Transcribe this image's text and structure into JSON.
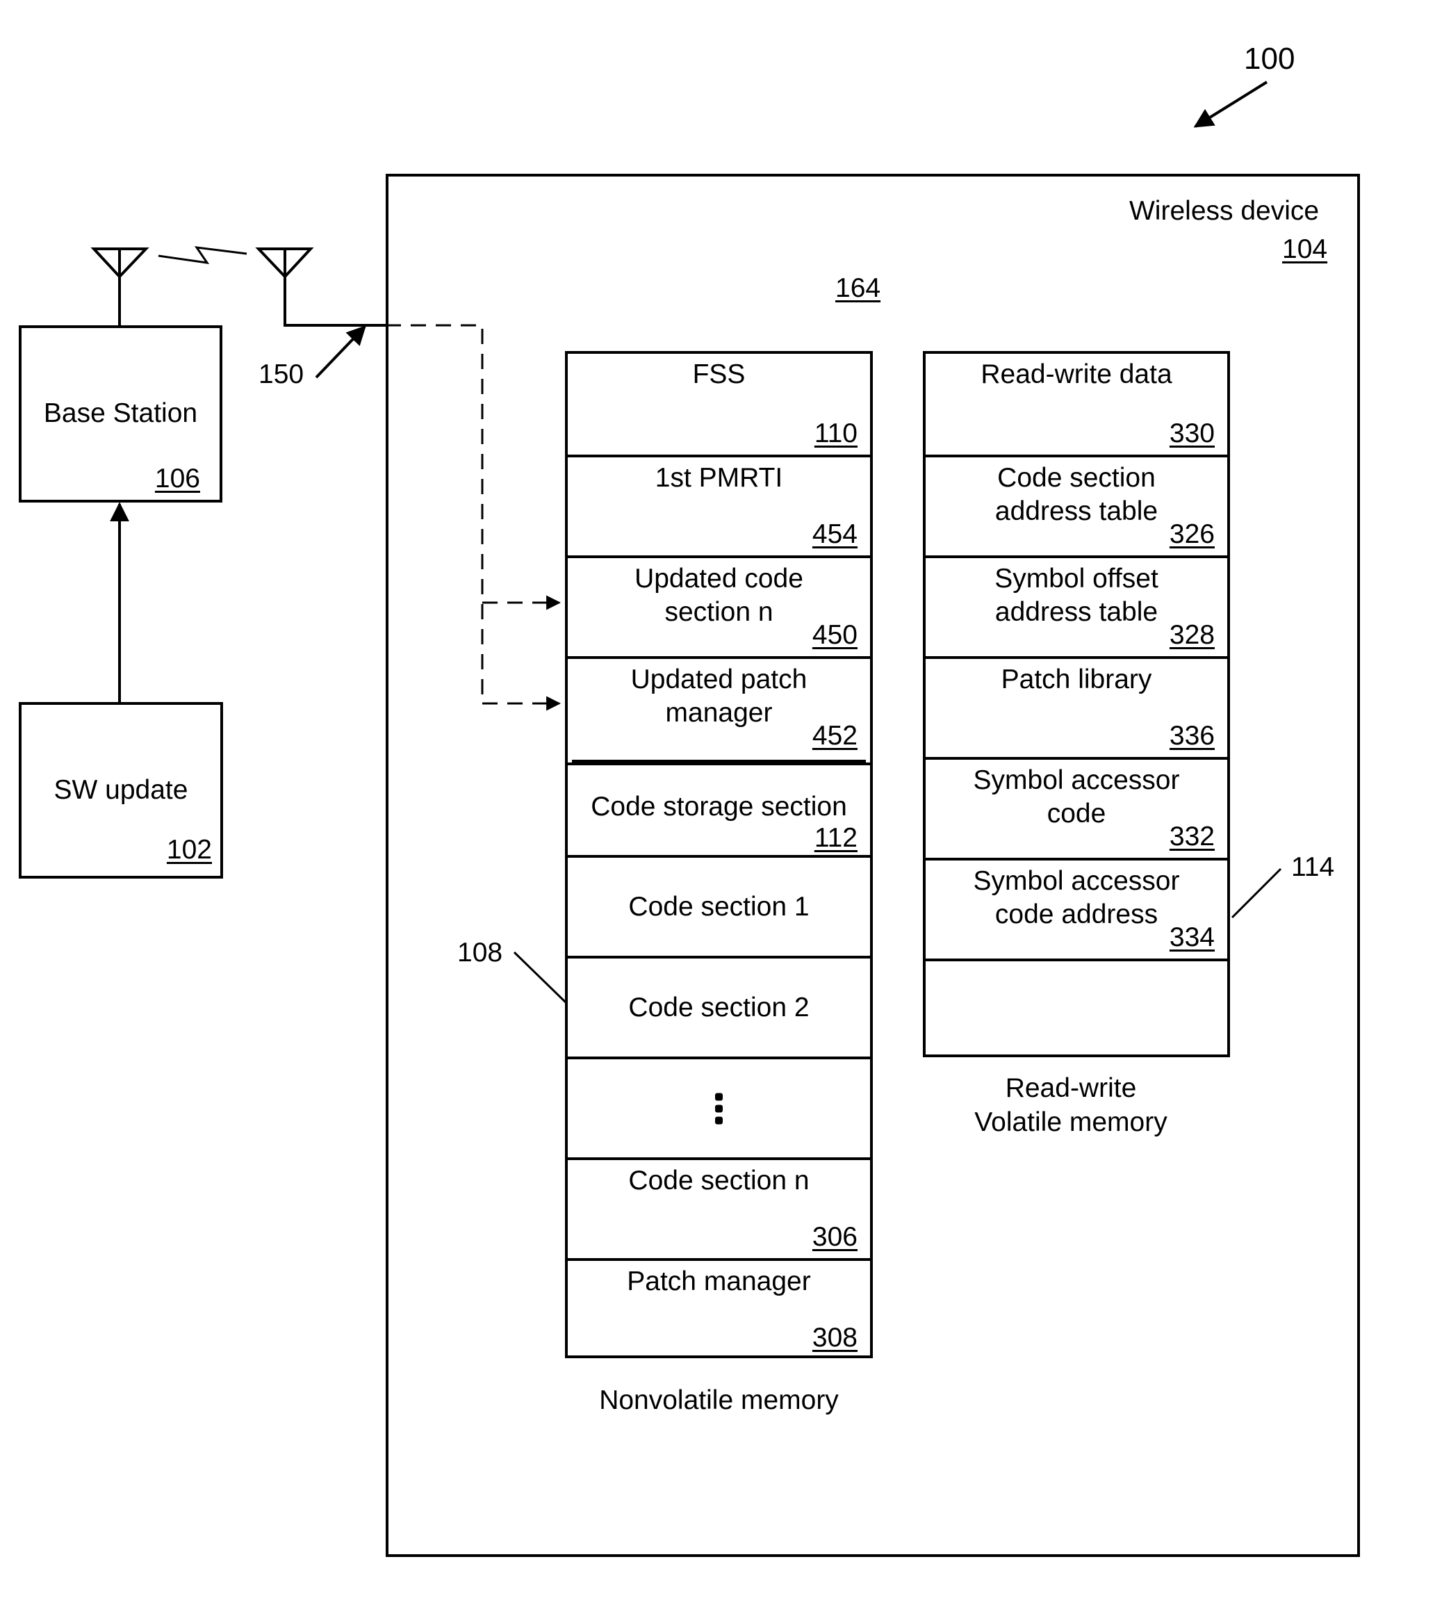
{
  "figure": {
    "reference": "100"
  },
  "sw_update": {
    "label": "SW update",
    "ref": "102"
  },
  "base_station": {
    "label": "Base Station",
    "ref": "106"
  },
  "link_ref": "150",
  "wireless_device": {
    "label": "Wireless device",
    "ref": "104",
    "inner_ref": "164"
  },
  "nonvolatile_memory": {
    "caption": "Nonvolatile memory",
    "ref": "108",
    "rows": [
      {
        "title": "FSS",
        "ref": "110"
      },
      {
        "title": "1st PMRTI",
        "ref": "454"
      },
      {
        "title": "Updated code\nsection n",
        "ref": "450"
      },
      {
        "title": "Updated patch\nmanager",
        "ref": "452"
      },
      {
        "title": "Code storage section",
        "ref": "112"
      },
      {
        "title": "Code section 1",
        "ref": ""
      },
      {
        "title": "Code section 2",
        "ref": ""
      },
      {
        "title": "",
        "ref": "",
        "ellipsis": true
      },
      {
        "title": "Code section n",
        "ref": "306"
      },
      {
        "title": "Patch manager",
        "ref": "308"
      }
    ]
  },
  "volatile_memory": {
    "caption_line1": "Read-write",
    "caption_line2": "Volatile memory",
    "ref": "114",
    "rows": [
      {
        "title": "Read-write data",
        "ref": "330"
      },
      {
        "title": "Code section\naddress table",
        "ref": "326"
      },
      {
        "title": "Symbol offset\naddress table",
        "ref": "328"
      },
      {
        "title": "Patch library",
        "ref": "336"
      },
      {
        "title": "Symbol accessor\ncode",
        "ref": "332"
      },
      {
        "title": "Symbol accessor\ncode address",
        "ref": "334"
      },
      {
        "title": "",
        "ref": ""
      }
    ]
  }
}
